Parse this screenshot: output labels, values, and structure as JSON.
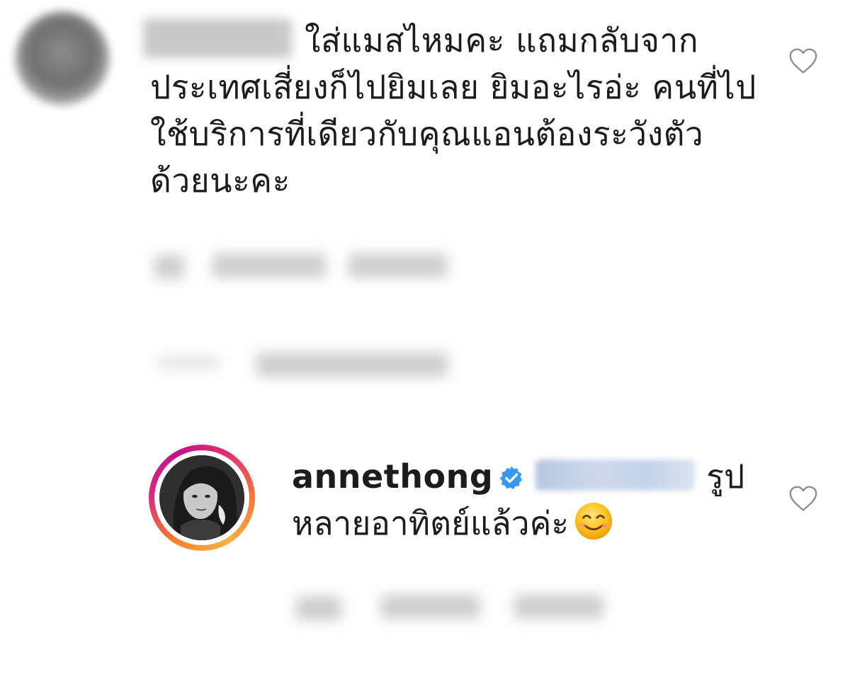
{
  "comments": [
    {
      "username": "",
      "text": "ใส่แมสไหมคะ แถมกลับจากประเทศเสี่ยงก็ไปยิมเลย ยิมอะไรอ่ะ คนที่ไปใช้บริการที่เดียวกับคุณแอนต้องระวังตัวด้วยนะคะ",
      "verified": false,
      "like_icon": "heart-outline-icon"
    },
    {
      "username": "annethong",
      "verified": true,
      "verified_icon": "verified-badge-icon",
      "mention": "",
      "text_line_1": "รูป",
      "text_line_2": "หลายอาทิตย์แล้วค่ะ",
      "emoji": "smiling-face-emoji",
      "like_icon": "heart-outline-icon"
    }
  ],
  "colors": {
    "text": "#262626",
    "verified_blue": "#3897f0",
    "story_ring_start": "#f58529",
    "story_ring_end": "#dd2a7b",
    "heart_outline": "#8e8e8e"
  }
}
